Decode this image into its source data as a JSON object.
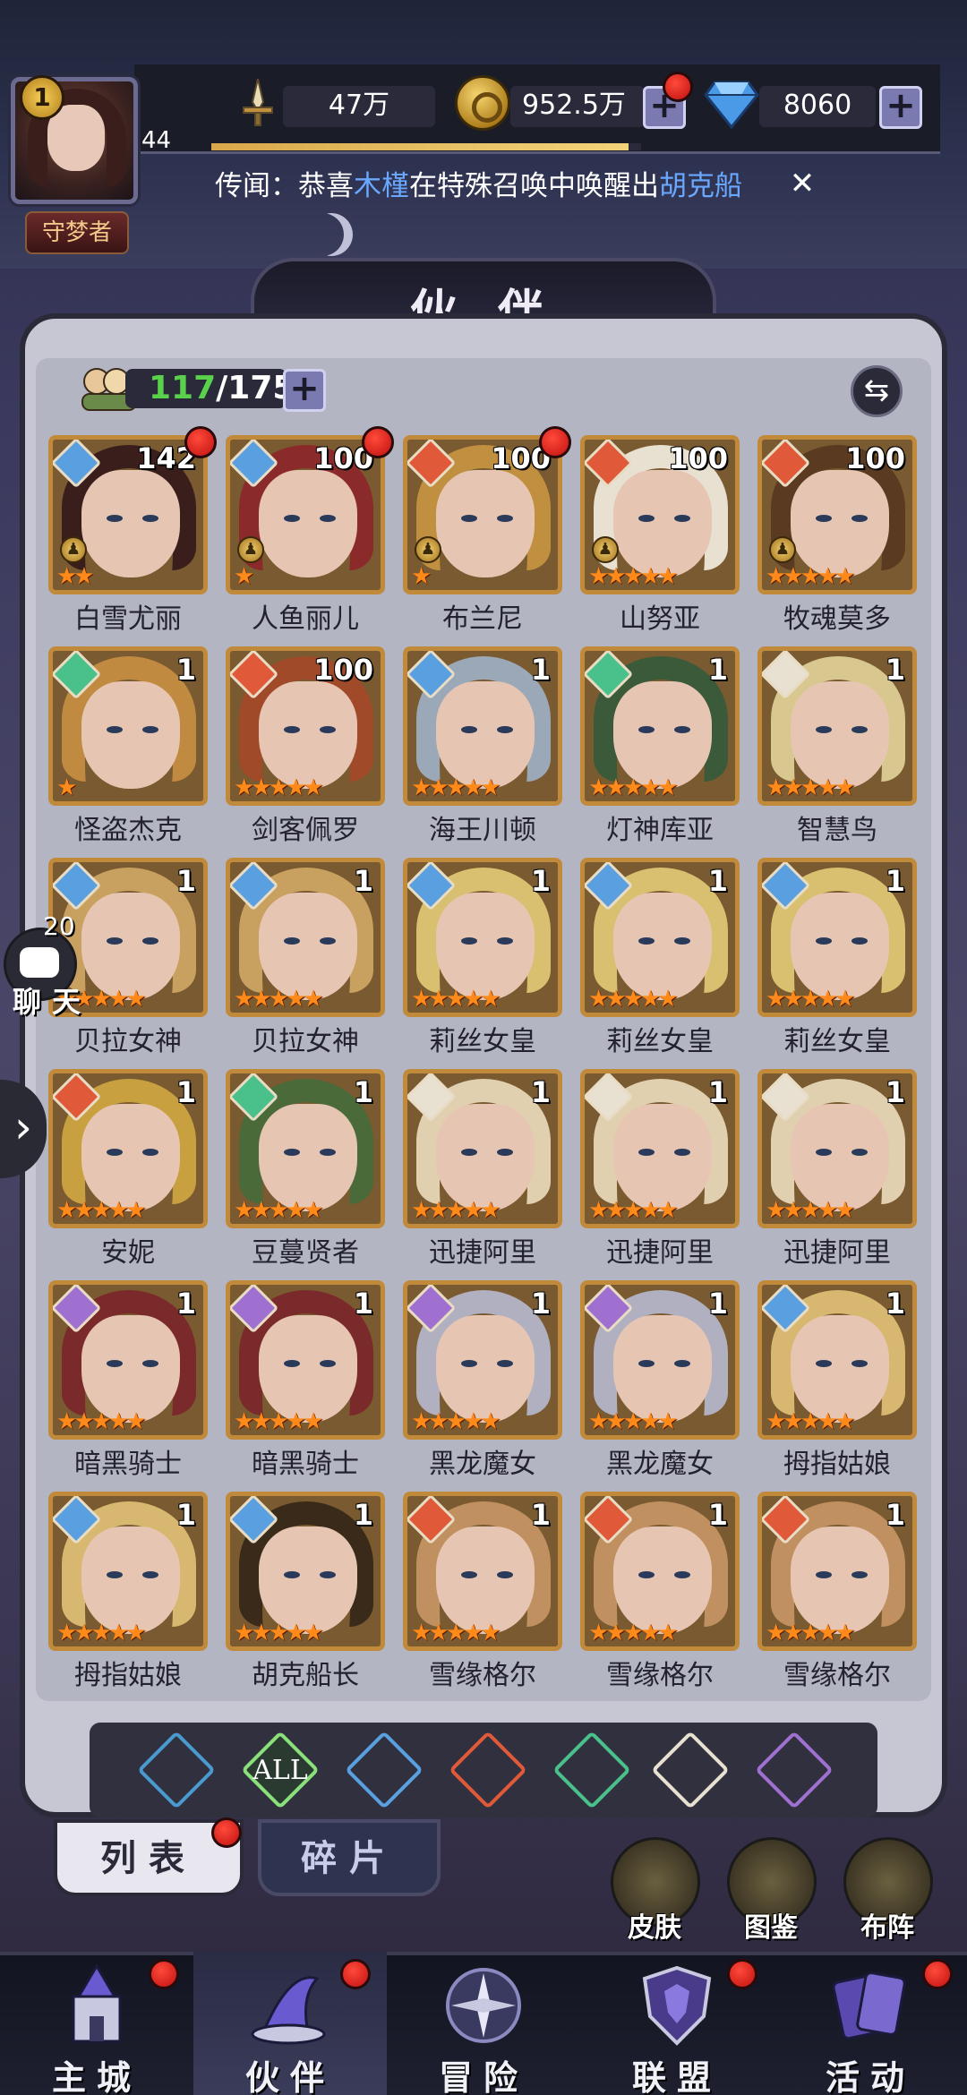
{
  "player": {
    "rank": "1",
    "level": "44",
    "title": "守梦者"
  },
  "resources": {
    "power": "47万",
    "gold": "952.5万",
    "diamonds": "8060"
  },
  "rumor": {
    "prefix": "传闻：恭喜",
    "player": "木槿",
    "middle": "在特殊召唤中唤醒出",
    "hero": "胡克船"
  },
  "exp_fraction": 0.97,
  "page_title": "伙 伴",
  "capacity": {
    "current": "117",
    "max": "/175"
  },
  "heroes": [
    {
      "name": "白雪尤丽",
      "level": "142",
      "stars": "★★",
      "elem": "water",
      "badge": true,
      "dot": true
    },
    {
      "name": "人鱼丽儿",
      "level": "100",
      "stars": "★",
      "elem": "water",
      "badge": true,
      "dot": true
    },
    {
      "name": "布兰尼",
      "level": "100",
      "stars": "★",
      "elem": "fire",
      "badge": true,
      "dot": true
    },
    {
      "name": "山努亚",
      "level": "100",
      "stars": "★★★★★",
      "elem": "fire",
      "badge": true,
      "dot": false
    },
    {
      "name": "牧魂莫多",
      "level": "100",
      "stars": "★★★★★",
      "elem": "fire",
      "badge": true,
      "dot": false
    },
    {
      "name": "怪盗杰克",
      "level": "1",
      "stars": "★",
      "elem": "wind",
      "badge": false,
      "dot": false
    },
    {
      "name": "剑客佩罗",
      "level": "100",
      "stars": "★★★★★",
      "elem": "fire",
      "badge": false,
      "dot": false
    },
    {
      "name": "海王川顿",
      "level": "1",
      "stars": "★★★★★",
      "elem": "water",
      "badge": false,
      "dot": false
    },
    {
      "name": "灯神库亚",
      "level": "1",
      "stars": "★★★★★",
      "elem": "wind",
      "badge": false,
      "dot": false
    },
    {
      "name": "智慧鸟",
      "level": "1",
      "stars": "★★★★★",
      "elem": "light",
      "badge": false,
      "dot": false
    },
    {
      "name": "贝拉女神",
      "level": "1",
      "stars": "★★★★★",
      "elem": "water",
      "badge": false,
      "dot": false
    },
    {
      "name": "贝拉女神",
      "level": "1",
      "stars": "★★★★★",
      "elem": "water",
      "badge": false,
      "dot": false
    },
    {
      "name": "莉丝女皇",
      "level": "1",
      "stars": "★★★★★",
      "elem": "water",
      "badge": false,
      "dot": false
    },
    {
      "name": "莉丝女皇",
      "level": "1",
      "stars": "★★★★★",
      "elem": "water",
      "badge": false,
      "dot": false
    },
    {
      "name": "莉丝女皇",
      "level": "1",
      "stars": "★★★★★",
      "elem": "water",
      "badge": false,
      "dot": false
    },
    {
      "name": "安妮",
      "level": "1",
      "stars": "★★★★★",
      "elem": "fire",
      "badge": false,
      "dot": false
    },
    {
      "name": "豆蔓贤者",
      "level": "1",
      "stars": "★★★★★",
      "elem": "wind",
      "badge": false,
      "dot": false
    },
    {
      "name": "迅捷阿里",
      "level": "1",
      "stars": "★★★★★",
      "elem": "light",
      "badge": false,
      "dot": false
    },
    {
      "name": "迅捷阿里",
      "level": "1",
      "stars": "★★★★★",
      "elem": "light",
      "badge": false,
      "dot": false
    },
    {
      "name": "迅捷阿里",
      "level": "1",
      "stars": "★★★★★",
      "elem": "light",
      "badge": false,
      "dot": false
    },
    {
      "name": "暗黑骑士",
      "level": "1",
      "stars": "★★★★★",
      "elem": "dark",
      "badge": false,
      "dot": false
    },
    {
      "name": "暗黑骑士",
      "level": "1",
      "stars": "★★★★★",
      "elem": "dark",
      "badge": false,
      "dot": false
    },
    {
      "name": "黑龙魔女",
      "level": "1",
      "stars": "★★★★★",
      "elem": "dark",
      "badge": false,
      "dot": false
    },
    {
      "name": "黑龙魔女",
      "level": "1",
      "stars": "★★★★★",
      "elem": "dark",
      "badge": false,
      "dot": false
    },
    {
      "name": "拇指姑娘",
      "level": "1",
      "stars": "★★★★★",
      "elem": "water",
      "badge": false,
      "dot": false
    },
    {
      "name": "拇指姑娘",
      "level": "1",
      "stars": "★★★★★",
      "elem": "water",
      "badge": false,
      "dot": false
    },
    {
      "name": "胡克船长",
      "level": "1",
      "stars": "★★★★★",
      "elem": "water",
      "badge": false,
      "dot": false
    },
    {
      "name": "雪缘格尔",
      "level": "1",
      "stars": "★★★★★",
      "elem": "fire",
      "badge": false,
      "dot": false
    },
    {
      "name": "雪缘格尔",
      "level": "1",
      "stars": "★★★★★",
      "elem": "fire",
      "badge": false,
      "dot": false
    },
    {
      "name": "雪缘格尔",
      "level": "1",
      "stars": "★★★★★",
      "elem": "fire",
      "badge": false,
      "dot": false
    }
  ],
  "element_colors": {
    "water": "#5aa0e0",
    "fire": "#e05a3a",
    "wind": "#4ac08a",
    "light": "#e8e0d0",
    "dark": "#a070d0"
  },
  "filters": {
    "all_label": "ALL"
  },
  "tabs": {
    "list": "列表",
    "fragments": "碎片"
  },
  "side_buttons": {
    "skin": "皮肤",
    "codex": "图鉴",
    "formation": "布阵"
  },
  "chat": {
    "count": "20",
    "label": "聊天"
  },
  "nav": {
    "main_city": "主城",
    "partners": "伙伴",
    "adventure": "冒险",
    "alliance": "联盟",
    "events": "活动"
  }
}
